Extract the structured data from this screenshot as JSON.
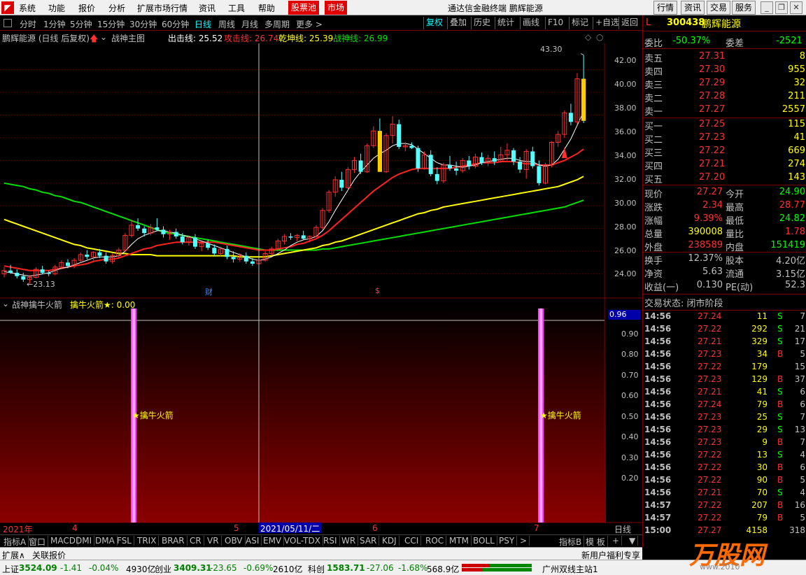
{
  "menu": {
    "items": [
      "系统",
      "功能",
      "报价",
      "分析",
      "扩展市场行情",
      "资讯",
      "工具",
      "帮助"
    ],
    "highlight1": "股票池",
    "highlight2": "市场",
    "window_title": "通达信金融终端  鹏辉能源",
    "right_buttons": [
      "行情",
      "资讯",
      "交易",
      "服务"
    ]
  },
  "toolbar": {
    "periods": [
      "分时",
      "1分钟",
      "5分钟",
      "15分钟",
      "30分钟",
      "60分钟",
      "日线",
      "周线",
      "月线",
      "多周期",
      "更多 >"
    ],
    "right": [
      "复权",
      "叠加",
      "历史",
      "统计",
      "画线",
      "F10",
      "标记",
      "+自选",
      "返回"
    ]
  },
  "chart_header": {
    "name": "鹏辉能源 (日线 后复权)",
    "indicator_name": "战神主图",
    "l1_label": "出击线: 25.52",
    "l2_label": "攻击线: 26.74",
    "l3_label": "乾坤线: 25.39",
    "l4_label": "战神线: 26.99",
    "colors": {
      "l1": "#ffffff",
      "l2": "#ff3030",
      "l3": "#ffff00",
      "l4": "#00e000"
    }
  },
  "main_axis": {
    "ticks": [
      "42.00",
      "40.00",
      "38.00",
      "36.00",
      "34.00",
      "32.00",
      "30.00",
      "28.00",
      "26.00",
      "24.00"
    ],
    "ymin": 22.0,
    "ymax": 44.2
  },
  "annotations": {
    "high": "43.30",
    "low": "23.13",
    "fin_marker": "财",
    "s_marker": "$"
  },
  "sub_chart": {
    "header_name": "战神擒牛火箭",
    "header_value": "擒牛火箭★: 0.00",
    "signal_label": "★擒牛火箭",
    "cursor_value": "0.96",
    "ticks": [
      "0.90",
      "0.80",
      "0.70",
      "0.60",
      "0.50",
      "0.40",
      "0.30",
      "0.20"
    ],
    "signal_color": "#ff40ff"
  },
  "date_axis": {
    "year": "2021年",
    "m4": "4",
    "m5": "5",
    "cursor_date": "2021/05/11/二",
    "m6": "6",
    "m7": "7",
    "period": "日线"
  },
  "bottom_tabs": [
    "指标A",
    "窗口",
    "MACD",
    "DMI",
    "DMA",
    "FSL",
    "TRIX",
    "BRAR",
    "CR",
    "VR",
    "OBV",
    "ASI",
    "EMV",
    "VOL-TDX",
    "RSI",
    "WR",
    "SAR",
    "KDJ",
    "CCI",
    "ROC",
    "MTM",
    "BOLL",
    "PSY",
    ">",
    "指标B",
    "模 板",
    "+",
    "▼"
  ],
  "ext_bar": {
    "left": "扩展∧",
    "link": "关联报价",
    "right": "新用户福利专享"
  },
  "quote": {
    "code": "300438",
    "name": "鹏辉能源",
    "weibi_label": "委比",
    "weibi": "-50.37%",
    "weicha_label": "委差",
    "weicha": "-2521",
    "asks": [
      {
        "label": "卖五",
        "price": "27.31",
        "vol": "8"
      },
      {
        "label": "卖四",
        "price": "27.30",
        "vol": "955"
      },
      {
        "label": "卖三",
        "price": "27.29",
        "vol": "32"
      },
      {
        "label": "卖二",
        "price": "27.28",
        "vol": "211"
      },
      {
        "label": "卖一",
        "price": "27.27",
        "vol": "2557"
      }
    ],
    "bids": [
      {
        "label": "买一",
        "price": "27.25",
        "vol": "115"
      },
      {
        "label": "买二",
        "price": "27.23",
        "vol": "41"
      },
      {
        "label": "买三",
        "price": "27.22",
        "vol": "669"
      },
      {
        "label": "买四",
        "price": "27.21",
        "vol": "274"
      },
      {
        "label": "买五",
        "price": "27.20",
        "vol": "143"
      }
    ],
    "stats": [
      {
        "l1": "现价",
        "v1": "27.27",
        "c1": "#ff3030",
        "l2": "今开",
        "v2": "24.90",
        "c2": "#00ff00"
      },
      {
        "l1": "涨跌",
        "v1": "2.34",
        "c1": "#ff3030",
        "l2": "最高",
        "v2": "28.77",
        "c2": "#ff3030"
      },
      {
        "l1": "涨幅",
        "v1": "9.39%",
        "c1": "#ff3030",
        "l2": "最低",
        "v2": "24.82",
        "c2": "#00ff00"
      },
      {
        "l1": "总量",
        "v1": "390008",
        "c1": "#ffff00",
        "l2": "量比",
        "v2": "1.78",
        "c2": "#ff3030"
      },
      {
        "l1": "外盘",
        "v1": "238589",
        "c1": "#ff3030",
        "l2": "内盘",
        "v2": "151419",
        "c2": "#00ff00"
      },
      {
        "l1": "换手",
        "v1": "12.37%",
        "c1": "#c0c0c0",
        "l2": "股本",
        "v2": "4.20亿",
        "c2": "#c0c0c0"
      },
      {
        "l1": "净资",
        "v1": "5.63",
        "c1": "#c0c0c0",
        "l2": "流通",
        "v2": "3.15亿",
        "c2": "#c0c0c0"
      },
      {
        "l1": "收益(一)",
        "v1": "0.130",
        "c1": "#c0c0c0",
        "l2": "PE(动)",
        "v2": "52.3",
        "c2": "#c0c0c0"
      }
    ],
    "trade_state": "交易状态: 闭市阶段",
    "trades": [
      {
        "t": "14:56",
        "p": "27.24",
        "v": "11",
        "d": "S",
        "n": "7"
      },
      {
        "t": "14:56",
        "p": "27.22",
        "v": "292",
        "d": "S",
        "n": "21"
      },
      {
        "t": "14:56",
        "p": "27.21",
        "v": "329",
        "d": "S",
        "n": "17"
      },
      {
        "t": "14:56",
        "p": "27.23",
        "v": "34",
        "d": "B",
        "n": "5"
      },
      {
        "t": "14:56",
        "p": "27.22",
        "v": "179",
        "d": "",
        "n": "15"
      },
      {
        "t": "14:56",
        "p": "27.23",
        "v": "129",
        "d": "B",
        "n": "37"
      },
      {
        "t": "14:56",
        "p": "27.21",
        "v": "41",
        "d": "S",
        "n": "6"
      },
      {
        "t": "14:56",
        "p": "27.24",
        "v": "79",
        "d": "B",
        "n": "6"
      },
      {
        "t": "14:56",
        "p": "27.23",
        "v": "25",
        "d": "S",
        "n": "7"
      },
      {
        "t": "14:56",
        "p": "27.23",
        "v": "29",
        "d": "S",
        "n": "13"
      },
      {
        "t": "14:56",
        "p": "27.23",
        "v": "9",
        "d": "B",
        "n": "7"
      },
      {
        "t": "14:56",
        "p": "27.22",
        "v": "13",
        "d": "S",
        "n": "4"
      },
      {
        "t": "14:56",
        "p": "27.22",
        "v": "30",
        "d": "B",
        "n": "6"
      },
      {
        "t": "14:56",
        "p": "27.22",
        "v": "90",
        "d": "B",
        "n": "5"
      },
      {
        "t": "14:56",
        "p": "27.21",
        "v": "70",
        "d": "S",
        "n": "4"
      },
      {
        "t": "14:57",
        "p": "27.22",
        "v": "207",
        "d": "B",
        "n": "16"
      },
      {
        "t": "14:57",
        "p": "27.22",
        "v": "79",
        "d": "B",
        "n": "5"
      },
      {
        "t": "15:00",
        "p": "27.27",
        "v": "4158",
        "d": "",
        "n": "318"
      }
    ]
  },
  "status": {
    "sh_label": "上证",
    "sh_val": "3524.09",
    "sh_chg": "-1.41",
    "sh_pct": "-0.04%",
    "sh_amt": "4930亿",
    "cy_label": "创业",
    "cy_val": "3409.31",
    "cy_chg": "-23.65",
    "cy_pct": "-0.69%",
    "cy_amt": "2610亿",
    "kc_label": "科创",
    "kc_val": "1583.71",
    "kc_chg": "-27.06",
    "kc_pct": "-1.68%",
    "kc_amt": "568.9亿",
    "server": "广州双线主站1",
    "watermark": "万股网",
    "watermark_url": "www.2010"
  },
  "chart_data": {
    "type": "candlestick",
    "ohlc": [
      [
        24.0,
        24.6,
        23.7,
        24.3
      ],
      [
        24.3,
        24.8,
        24.0,
        24.1
      ],
      [
        24.1,
        24.4,
        23.6,
        23.8
      ],
      [
        23.8,
        24.1,
        23.3,
        23.5
      ],
      [
        23.5,
        23.9,
        23.13,
        23.7
      ],
      [
        23.7,
        24.6,
        23.6,
        24.4
      ],
      [
        24.4,
        24.7,
        24.0,
        24.1
      ],
      [
        24.1,
        24.3,
        23.8,
        24.0
      ],
      [
        24.0,
        24.8,
        23.9,
        24.6
      ],
      [
        24.6,
        25.2,
        24.4,
        25.0
      ],
      [
        25.0,
        25.3,
        24.5,
        24.7
      ],
      [
        24.7,
        25.4,
        24.5,
        25.2
      ],
      [
        25.2,
        25.9,
        25.0,
        25.7
      ],
      [
        25.7,
        26.1,
        25.3,
        25.5
      ],
      [
        25.5,
        26.0,
        25.2,
        25.9
      ],
      [
        25.9,
        26.2,
        25.4,
        25.6
      ],
      [
        25.6,
        25.9,
        24.9,
        25.1
      ],
      [
        25.1,
        25.8,
        24.9,
        25.6
      ],
      [
        25.6,
        26.3,
        25.4,
        26.1
      ],
      [
        26.1,
        27.6,
        26.0,
        27.4
      ],
      [
        27.4,
        28.8,
        27.2,
        28.3
      ],
      [
        28.3,
        28.9,
        27.8,
        28.0
      ],
      [
        28.0,
        28.2,
        27.3,
        27.6
      ],
      [
        27.6,
        28.4,
        27.4,
        28.1
      ],
      [
        28.1,
        28.9,
        27.8,
        27.9
      ],
      [
        27.9,
        28.2,
        27.2,
        27.5
      ],
      [
        27.5,
        27.9,
        27.0,
        27.7
      ],
      [
        27.7,
        28.0,
        27.1,
        27.3
      ],
      [
        27.3,
        27.6,
        26.6,
        26.8
      ],
      [
        26.8,
        27.4,
        26.5,
        27.2
      ],
      [
        27.2,
        27.5,
        26.2,
        26.4
      ],
      [
        26.4,
        26.9,
        26.0,
        26.7
      ],
      [
        26.7,
        27.0,
        26.1,
        26.3
      ],
      [
        26.3,
        26.6,
        25.6,
        25.8
      ],
      [
        25.8,
        26.4,
        25.5,
        26.2
      ],
      [
        26.2,
        26.5,
        25.3,
        25.5
      ],
      [
        25.5,
        26.0,
        25.0,
        25.3
      ],
      [
        25.3,
        25.8,
        25.1,
        25.6
      ],
      [
        25.6,
        25.9,
        24.9,
        25.1
      ],
      [
        25.1,
        25.4,
        24.7,
        24.9
      ],
      [
        24.9,
        25.4,
        24.8,
        25.2
      ],
      [
        25.2,
        26.0,
        25.1,
        25.8
      ],
      [
        25.8,
        26.4,
        25.6,
        26.2
      ],
      [
        26.2,
        27.1,
        26.0,
        26.9
      ],
      [
        26.9,
        27.5,
        26.6,
        27.3
      ],
      [
        27.3,
        27.6,
        27.0,
        27.2
      ],
      [
        27.2,
        27.5,
        26.9,
        27.4
      ],
      [
        27.4,
        27.8,
        27.0,
        27.1
      ],
      [
        27.1,
        27.4,
        26.8,
        27.3
      ],
      [
        27.3,
        28.3,
        27.2,
        28.1
      ],
      [
        28.1,
        29.8,
        27.9,
        29.6
      ],
      [
        29.6,
        31.4,
        29.4,
        31.2
      ],
      [
        31.2,
        32.6,
        30.8,
        32.3
      ],
      [
        32.3,
        33.0,
        31.3,
        31.6
      ],
      [
        31.6,
        33.4,
        31.4,
        33.2
      ],
      [
        33.2,
        34.3,
        32.9,
        34.0
      ],
      [
        34.0,
        34.6,
        32.8,
        33.0
      ],
      [
        33.0,
        35.5,
        32.9,
        35.3
      ],
      [
        35.3,
        37.0,
        35.1,
        36.6
      ],
      [
        36.6,
        37.7,
        33.0,
        33.0
      ],
      [
        33.0,
        36.4,
        32.9,
        36.2
      ],
      [
        36.2,
        37.9,
        35.5,
        37.2
      ],
      [
        37.2,
        37.6,
        35.0,
        35.2
      ],
      [
        35.2,
        35.6,
        34.8,
        35.3
      ],
      [
        35.3,
        35.6,
        35.0,
        35.1
      ],
      [
        35.1,
        35.3,
        33.0,
        33.3
      ],
      [
        33.3,
        34.8,
        33.2,
        34.5
      ],
      [
        34.5,
        34.9,
        32.6,
        32.8
      ],
      [
        32.8,
        33.4,
        31.9,
        32.2
      ],
      [
        32.2,
        33.8,
        32.0,
        33.6
      ],
      [
        33.6,
        34.4,
        33.1,
        33.3
      ],
      [
        33.3,
        33.9,
        32.7,
        33.1
      ],
      [
        33.1,
        34.2,
        32.9,
        34.0
      ],
      [
        34.0,
        34.4,
        33.2,
        33.5
      ],
      [
        33.5,
        34.6,
        33.3,
        34.3
      ],
      [
        34.3,
        34.7,
        33.6,
        33.8
      ],
      [
        33.8,
        34.5,
        33.5,
        34.2
      ],
      [
        34.2,
        34.8,
        33.6,
        33.9
      ],
      [
        33.9,
        35.2,
        33.8,
        34.5
      ],
      [
        34.5,
        35.5,
        34.0,
        34.9
      ],
      [
        34.9,
        35.1,
        33.6,
        33.9
      ],
      [
        33.9,
        34.3,
        32.9,
        33.2
      ],
      [
        33.2,
        35.0,
        32.4,
        34.8
      ],
      [
        34.8,
        35.2,
        33.3,
        33.5
      ],
      [
        33.5,
        34.0,
        31.8,
        32.0
      ],
      [
        32.0,
        33.8,
        31.9,
        33.6
      ],
      [
        33.6,
        35.7,
        33.4,
        35.6
      ],
      [
        35.6,
        36.6,
        35.2,
        36.3
      ],
      [
        36.3,
        38.4,
        36.0,
        38.2
      ],
      [
        38.2,
        39.0,
        37.1,
        37.4
      ],
      [
        37.4,
        41.7,
        37.2,
        41.2
      ],
      [
        41.2,
        43.3,
        37.3,
        37.5
      ]
    ],
    "ma_white": [
      24.2,
      24.1,
      24.0,
      23.9,
      23.8,
      23.9,
      24.0,
      24.1,
      24.3,
      24.5,
      24.6,
      24.8,
      25.0,
      25.2,
      25.4,
      25.5,
      25.5,
      25.5,
      25.6,
      26.0,
      26.6,
      27.1,
      27.4,
      27.6,
      27.8,
      27.8,
      27.7,
      27.6,
      27.4,
      27.3,
      27.1,
      26.9,
      26.7,
      26.5,
      26.3,
      26.1,
      25.9,
      25.7,
      25.5,
      25.3,
      25.2,
      25.3,
      25.5,
      25.8,
      26.1,
      26.5,
      26.8,
      27.0,
      27.1,
      27.3,
      27.8,
      28.6,
      29.6,
      30.5,
      31.4,
      32.3,
      33.0,
      33.6,
      34.2,
      34.6,
      34.9,
      35.3,
      35.5,
      35.5,
      35.4,
      35.0,
      34.6,
      34.2,
      33.8,
      33.6,
      33.6,
      33.5,
      33.4,
      33.5,
      33.6,
      33.8,
      33.9,
      34.0,
      34.1,
      34.2,
      34.2,
      34.0,
      33.9,
      33.9,
      33.6,
      33.5,
      33.6,
      34.1,
      35.0,
      35.9,
      37.1,
      38.3
    ],
    "ma_red": [
      24.7,
      24.6,
      24.5,
      24.4,
      24.3,
      24.3,
      24.3,
      24.3,
      24.4,
      24.5,
      24.6,
      24.7,
      24.8,
      24.9,
      25.1,
      25.2,
      25.3,
      25.3,
      25.4,
      25.6,
      25.8,
      26.0,
      26.2,
      26.3,
      26.5,
      26.6,
      26.7,
      26.8,
      26.8,
      26.8,
      26.8,
      26.8,
      26.8,
      26.8,
      26.7,
      26.6,
      26.5,
      26.4,
      26.3,
      26.2,
      26.1,
      26.1,
      26.1,
      26.2,
      26.3,
      26.4,
      26.6,
      26.7,
      26.9,
      27.1,
      27.4,
      27.8,
      28.3,
      28.8,
      29.3,
      29.8,
      30.3,
      30.8,
      31.3,
      31.7,
      32.1,
      32.5,
      32.8,
      33.0,
      33.2,
      33.3,
      33.3,
      33.3,
      33.3,
      33.3,
      33.3,
      33.4,
      33.5,
      33.6,
      33.7,
      33.8,
      33.8,
      33.8,
      33.9,
      33.9,
      33.9,
      33.8,
      33.7,
      33.7,
      33.6,
      33.6,
      33.6,
      33.8,
      34.0,
      34.3,
      34.6,
      35.0
    ],
    "ma_yellow": [
      28.8,
      28.6,
      28.4,
      28.2,
      28.0,
      27.8,
      27.6,
      27.4,
      27.2,
      27.0,
      26.8,
      26.6,
      26.5,
      26.3,
      26.2,
      26.1,
      26.0,
      25.9,
      25.8,
      25.8,
      25.7,
      25.7,
      25.7,
      25.7,
      25.6,
      25.6,
      25.6,
      25.6,
      25.6,
      25.6,
      25.6,
      25.6,
      25.6,
      25.6,
      25.6,
      25.6,
      25.6,
      25.5,
      25.5,
      25.5,
      25.5,
      25.5,
      25.6,
      25.7,
      25.8,
      25.9,
      26.0,
      26.1,
      26.2,
      26.3,
      26.5,
      26.6,
      26.8,
      26.9,
      27.1,
      27.3,
      27.5,
      27.7,
      27.9,
      28.1,
      28.3,
      28.5,
      28.7,
      28.9,
      29.1,
      29.3,
      29.4,
      29.6,
      29.7,
      29.9,
      30.0,
      30.1,
      30.2,
      30.3,
      30.4,
      30.5,
      30.6,
      30.7,
      30.8,
      30.9,
      31.0,
      31.1,
      31.2,
      31.3,
      31.4,
      31.5,
      31.6,
      31.7,
      31.9,
      32.1,
      32.3,
      32.6
    ],
    "ma_green": [
      32.0,
      31.9,
      31.8,
      31.7,
      31.5,
      31.4,
      31.2,
      31.1,
      30.9,
      30.8,
      30.6,
      30.4,
      30.3,
      30.1,
      29.9,
      29.7,
      29.5,
      29.3,
      29.1,
      28.9,
      28.7,
      28.5,
      28.3,
      28.1,
      27.9,
      27.7,
      27.6,
      27.5,
      27.4,
      27.3,
      27.2,
      27.1,
      27.0,
      26.9,
      26.8,
      26.7,
      26.6,
      26.5,
      26.4,
      26.3,
      26.2,
      26.1,
      26.1,
      26.1,
      26.1,
      26.1,
      26.1,
      26.1,
      26.1,
      26.1,
      26.2,
      26.2,
      26.3,
      26.4,
      26.5,
      26.6,
      26.7,
      26.8,
      26.9,
      27.0,
      27.1,
      27.2,
      27.3,
      27.4,
      27.5,
      27.6,
      27.7,
      27.8,
      27.9,
      28.0,
      28.1,
      28.2,
      28.3,
      28.4,
      28.5,
      28.6,
      28.7,
      28.8,
      28.9,
      29.0,
      29.1,
      29.2,
      29.3,
      29.4,
      29.5,
      29.6,
      29.7,
      29.8,
      29.9,
      30.1,
      30.3,
      30.5
    ],
    "signals_sub": [
      {
        "index": 22,
        "value": 1
      },
      {
        "index": 87,
        "value": 1
      }
    ],
    "ylim": [
      22.0,
      44.2
    ],
    "sub_ylim": [
      0.1,
      1.0
    ]
  }
}
